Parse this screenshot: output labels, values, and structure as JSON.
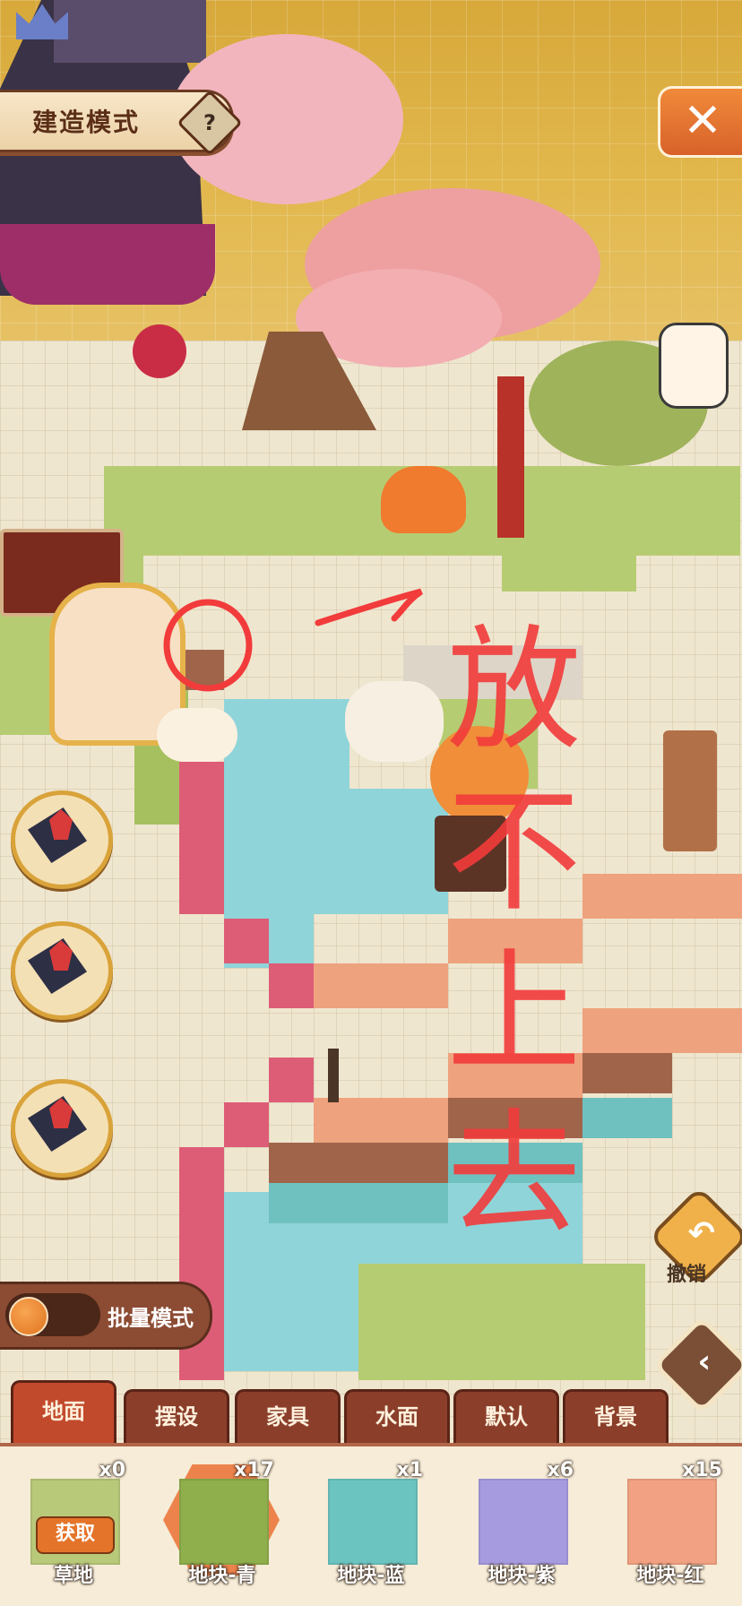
{
  "header": {
    "title": "建造模式",
    "help_symbol": "?",
    "close_symbol": "✕"
  },
  "scribble_text": "放不上去",
  "side_controls": {
    "undo_label": "撤销",
    "undo_symbol": "↶",
    "collapse_symbol": "‹"
  },
  "batch": {
    "label": "批量模式",
    "enabled": false
  },
  "tabs": [
    {
      "label": "地面",
      "active": true
    },
    {
      "label": "摆设",
      "active": false
    },
    {
      "label": "家具",
      "active": false
    },
    {
      "label": "水面",
      "active": false
    },
    {
      "label": "默认",
      "active": false
    },
    {
      "label": "背景",
      "active": false
    }
  ],
  "palette": [
    {
      "label": "草地",
      "count": "x0",
      "color": "#b9c97a",
      "action": "获取",
      "selected": false
    },
    {
      "label": "地块-青",
      "count": "x17",
      "color": "#8fae4c",
      "selected": true
    },
    {
      "label": "地块-蓝",
      "count": "x1",
      "color": "#6cc4c0",
      "selected": false
    },
    {
      "label": "地块-紫",
      "count": "x6",
      "color": "#a79be0",
      "selected": false
    },
    {
      "label": "地块-红",
      "count": "x15",
      "color": "#f2a283",
      "selected": false
    }
  ],
  "colors": {
    "accent": "#c24a2c",
    "annotation": "#f23b3b"
  }
}
